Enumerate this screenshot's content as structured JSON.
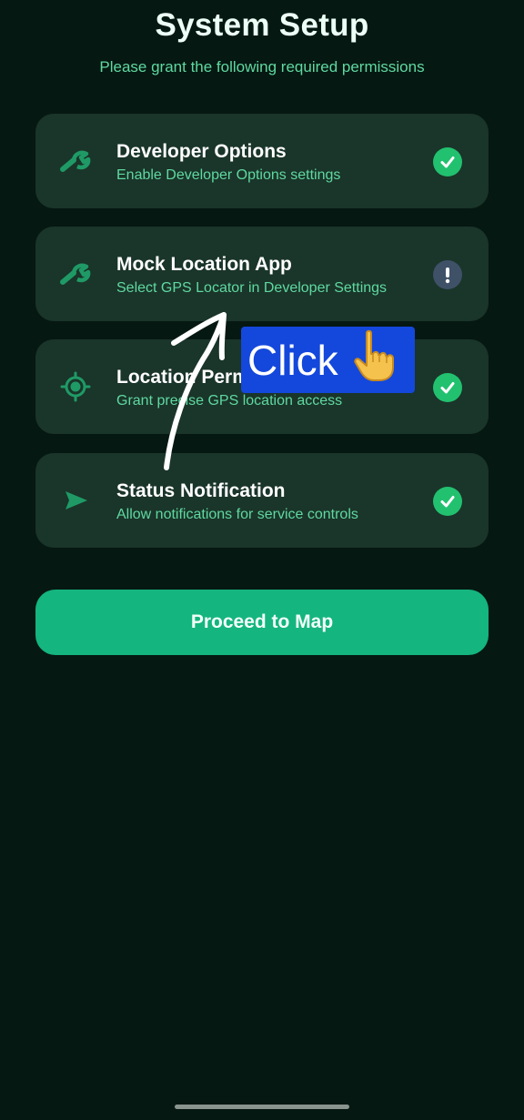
{
  "header": {
    "title": "System Setup",
    "subtitle": "Please grant the following required permissions"
  },
  "permissions": [
    {
      "icon": "wrench-icon",
      "label": "Developer Options",
      "description": "Enable Developer Options settings",
      "status": "granted"
    },
    {
      "icon": "wrench-icon",
      "label": "Mock Location App",
      "description": "Select GPS Locator in Developer Settings",
      "status": "pending"
    },
    {
      "icon": "gps-crosshair-icon",
      "label": "Location Permission",
      "description": "Grant precise GPS location access",
      "status": "granted"
    },
    {
      "icon": "send-arrow-icon",
      "label": "Status Notification",
      "description": "Allow notifications for service controls",
      "status": "granted"
    }
  ],
  "proceed_button": {
    "label": "Proceed to Map"
  },
  "overlay": {
    "click_label": "Click",
    "hand_icon": "pointing-hand-icon"
  },
  "colors": {
    "background": "#061812",
    "card": "#1a352a",
    "accent": "#14b57e",
    "status_ok": "#22c16f",
    "status_pending": "#3f5167",
    "subtitle_text": "#5fd9a0",
    "annotation_badge": "#1448dc"
  }
}
